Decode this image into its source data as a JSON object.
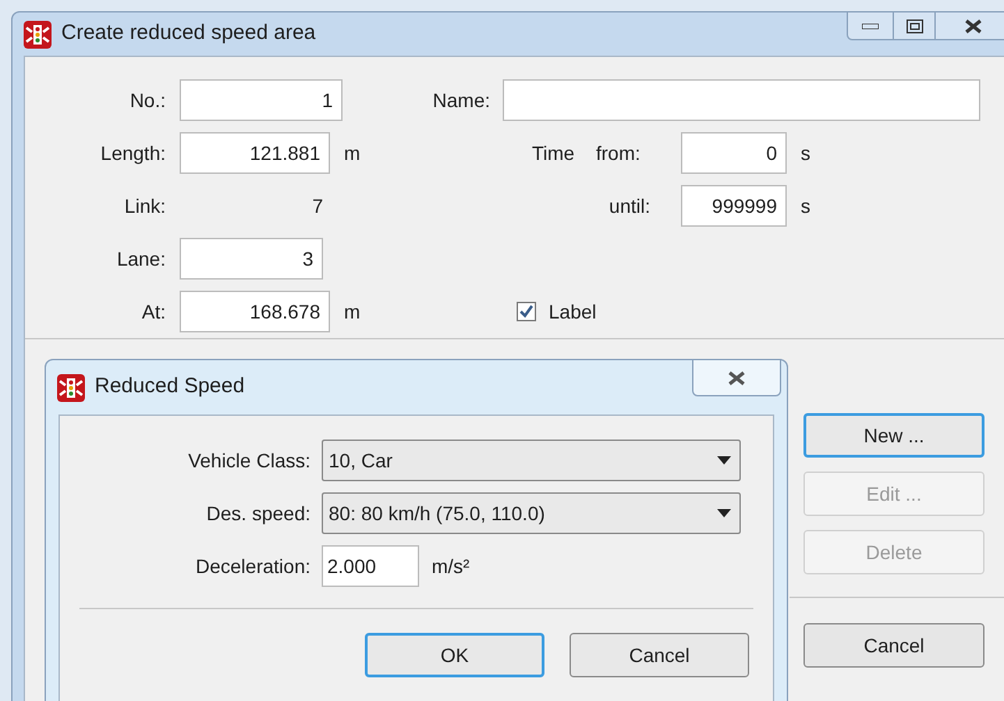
{
  "window": {
    "title": "Create reduced speed area"
  },
  "no": {
    "label": "No.:",
    "value": "1"
  },
  "name": {
    "label": "Name:"
  },
  "length": {
    "label": "Length:",
    "value": "121.881",
    "unit": "m"
  },
  "time": {
    "label": "Time",
    "from_label": "from:",
    "from_value": "0",
    "from_unit": "s",
    "until_label": "until:",
    "until_value": "999999",
    "until_unit": "s"
  },
  "link": {
    "label": "Link:",
    "value": "7"
  },
  "lane": {
    "label": "Lane:",
    "value": "3"
  },
  "at": {
    "label": "At:",
    "value": "168.678",
    "unit": "m"
  },
  "label_checkbox": {
    "label": "Label",
    "checked": true
  },
  "side_buttons": [
    {
      "label": "New ...",
      "disabled": false,
      "focused": true
    },
    {
      "label": "Edit ...",
      "disabled": true,
      "focused": false
    },
    {
      "label": "Delete",
      "disabled": true,
      "focused": false
    }
  ],
  "cancel_button": {
    "label": "Cancel"
  },
  "dialog": {
    "title": "Reduced Speed",
    "vehicle_class": {
      "label": "Vehicle Class:",
      "value": "10, Car"
    },
    "des_speed": {
      "label": "Des. speed:",
      "value": "80: 80 km/h (75.0, 110.0)"
    },
    "deceleration": {
      "label": "Deceleration:",
      "value": "2.000",
      "unit": "m/s²"
    },
    "buttons": [
      {
        "label": "OK",
        "focused": true
      },
      {
        "label": "Cancel",
        "focused": false
      }
    ]
  }
}
